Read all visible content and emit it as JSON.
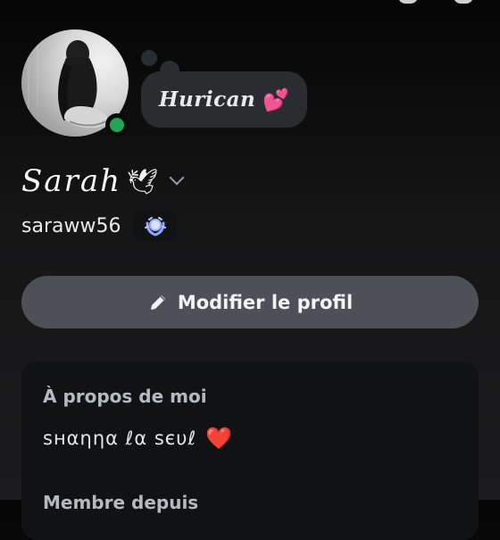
{
  "profile": {
    "custom_status": "Hurican",
    "custom_status_emoji": "💕",
    "display_name": "Sarah",
    "display_name_symbol": "🕊",
    "username": "saraww56",
    "status": "online"
  },
  "actions": {
    "edit_profile_label": "Modifier le profil"
  },
  "about": {
    "title": "À propos de moi",
    "text": "ѕнαηηα ℓα ѕєυℓ",
    "emoji": "❤️",
    "member_since_label": "Membre depuis"
  },
  "colors": {
    "online": "#23a559",
    "button": "#4e5058",
    "card": "#111214"
  },
  "icons": {
    "status_indicator": "online-dot-icon",
    "chevron": "chevron-down-icon",
    "badge": "nitro-badge-icon",
    "edit": "pencil-icon"
  }
}
